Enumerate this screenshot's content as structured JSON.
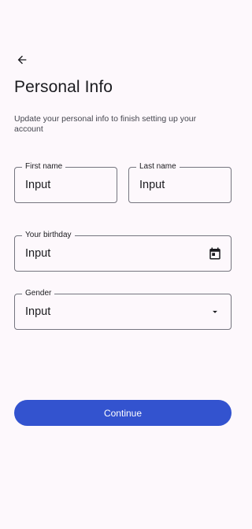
{
  "header": {
    "back_icon": "arrow-back-icon",
    "title": "Personal Info",
    "subtitle": "Update your personal info to finish setting up your account"
  },
  "form": {
    "first_name": {
      "label": "First name",
      "value": "Input"
    },
    "last_name": {
      "label": "Last name",
      "value": "Input"
    },
    "birthday": {
      "label": "Your birthday",
      "value": "Input",
      "icon": "calendar-icon"
    },
    "gender": {
      "label": "Gender",
      "value": "Input",
      "icon": "dropdown-arrow-icon"
    }
  },
  "actions": {
    "continue_label": "Continue"
  },
  "colors": {
    "background": "#fdf8fc",
    "primary": "#3353cf",
    "outline": "#75757f",
    "text": "#1b1b1f",
    "secondary_text": "#45464f"
  }
}
